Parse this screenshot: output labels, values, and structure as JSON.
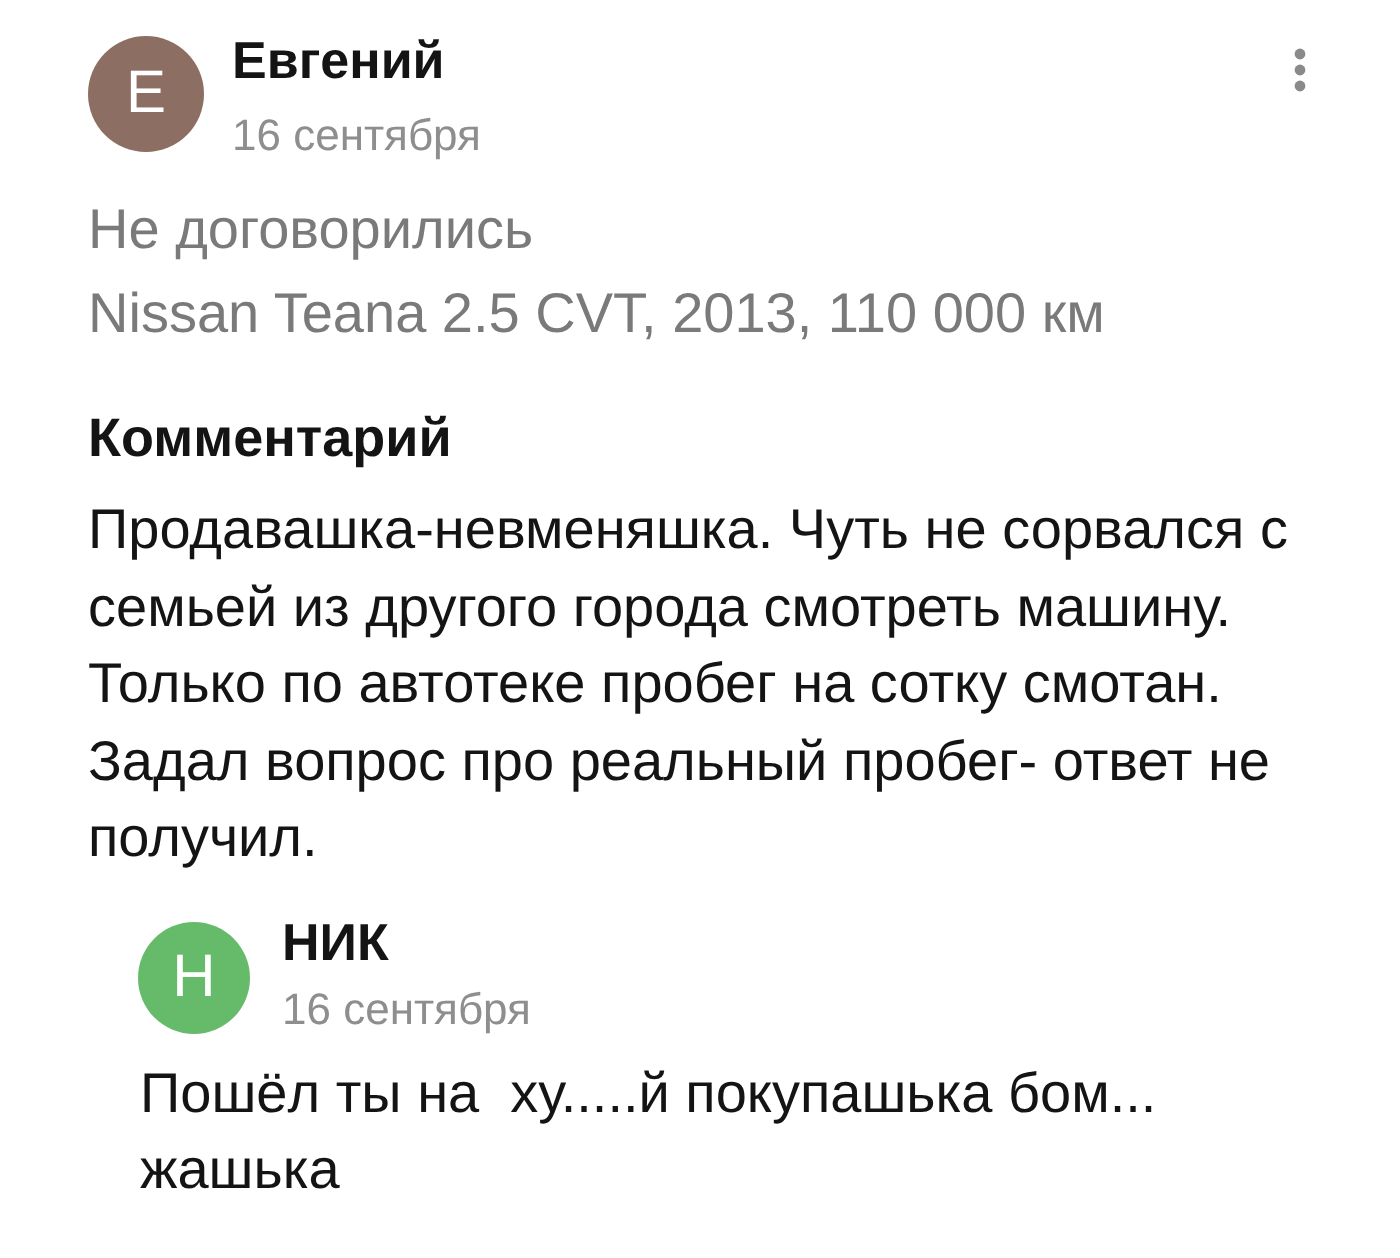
{
  "review": {
    "author": {
      "name": "Евгений",
      "initial": "Е",
      "color": "#8d6e63"
    },
    "date": "16 сентября",
    "status": "Не договорились",
    "car": "Nissan Teana 2.5 CVT, 2013, 110 000 км",
    "comment_heading": "Комментарий",
    "comment": "Продавашка-невменяшка. Чуть не сорвался с семьей из другого города смотреть машину. Только по автотеке пробег на сотку смотан. Задал вопрос про реальный пробег- ответ не получил."
  },
  "replies": [
    {
      "author": {
        "name": "НИК",
        "initial": "Н",
        "color": "#66bb6a"
      },
      "date": "16 сентября",
      "text": "Пошёл ты на  ху.....й покупашька бом...\nжашька"
    }
  ]
}
